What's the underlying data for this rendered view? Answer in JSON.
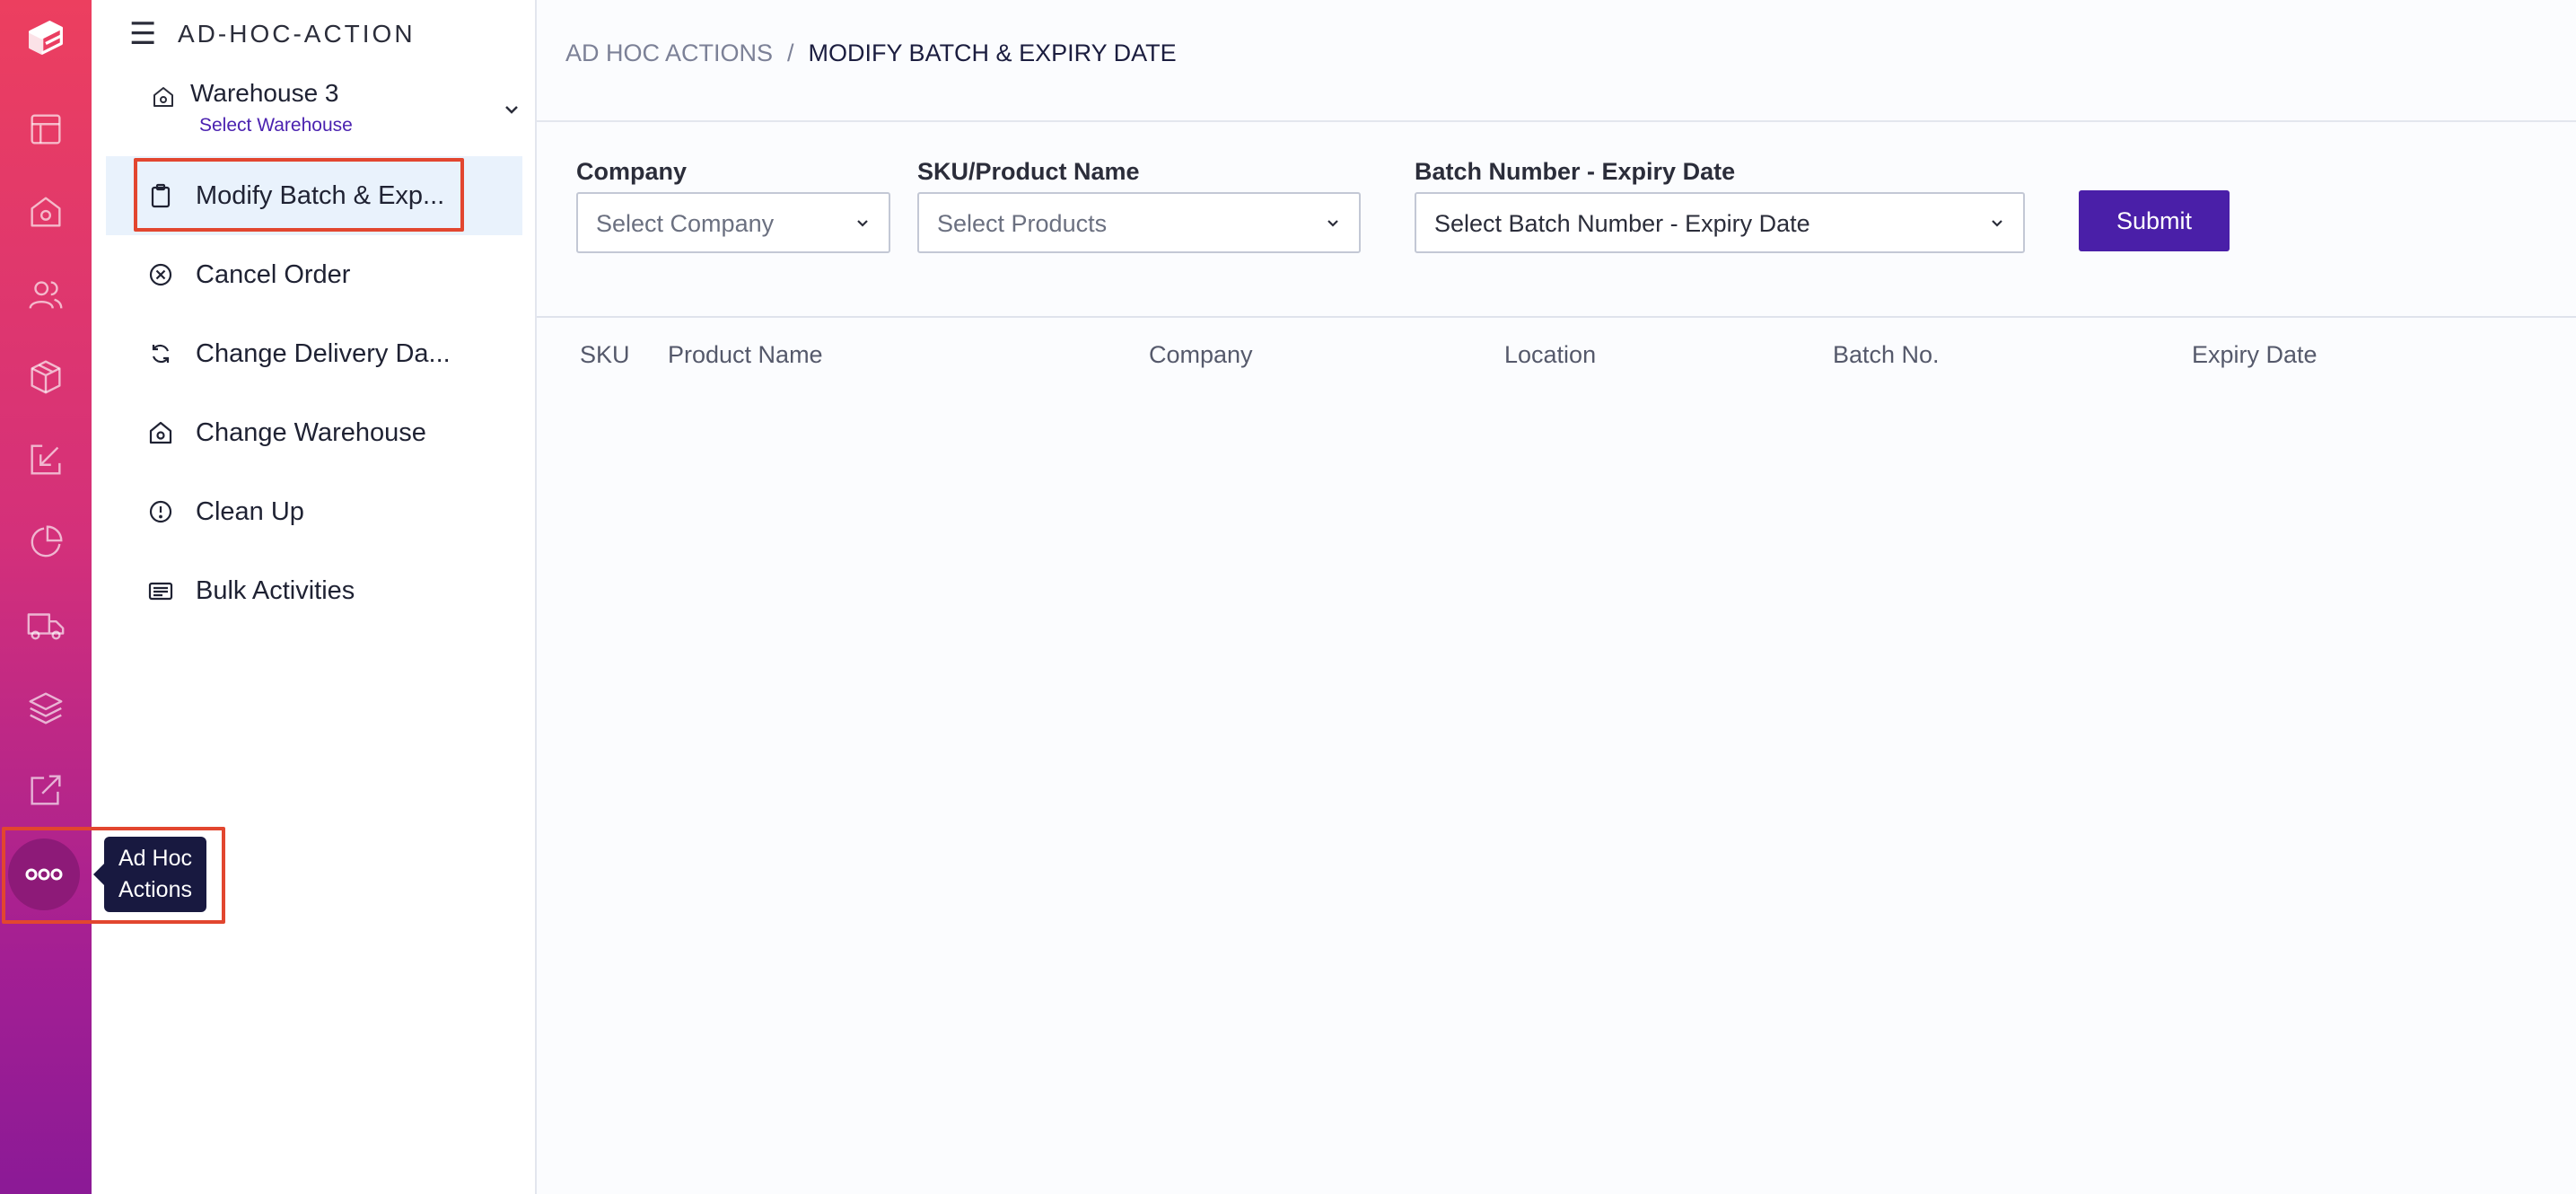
{
  "rail": {
    "icons": [
      "logo-icon",
      "dashboard-icon",
      "warehouse-icon",
      "users-icon",
      "package-icon",
      "inbound-icon",
      "reports-icon",
      "truck-icon",
      "layers-icon",
      "external-link-icon"
    ],
    "more_icon": "more-dots-icon"
  },
  "tooltip": {
    "text": "Ad Hoc\nActions"
  },
  "sidebar": {
    "title": "AD-HOC-ACTION",
    "warehouse": {
      "name": "Warehouse 3",
      "sublabel": "Select Warehouse"
    },
    "items": [
      {
        "label": "Modify Batch & Exp...",
        "icon": "clipboard-icon",
        "active": true
      },
      {
        "label": "Cancel Order",
        "icon": "cancel-circle-icon",
        "active": false
      },
      {
        "label": "Change Delivery Da...",
        "icon": "refresh-icon",
        "active": false
      },
      {
        "label": "Change Warehouse",
        "icon": "warehouse-icon",
        "active": false
      },
      {
        "label": "Clean Up",
        "icon": "alert-circle-icon",
        "active": false
      },
      {
        "label": "Bulk Activities",
        "icon": "list-card-icon",
        "active": false
      }
    ]
  },
  "breadcrumb": {
    "parent": "AD HOC ACTIONS",
    "separator": "/",
    "current": "MODIFY BATCH & EXPIRY DATE"
  },
  "filters": {
    "company": {
      "label": "Company",
      "placeholder": "Select Company"
    },
    "product": {
      "label": "SKU/Product Name",
      "placeholder": "Select Products"
    },
    "batch": {
      "label": "Batch Number - Expiry Date",
      "placeholder": "Select Batch Number - Expiry Date"
    },
    "submit_label": "Submit"
  },
  "table": {
    "columns": [
      "SKU",
      "Product Name",
      "Company",
      "Location",
      "Batch No.",
      "Expiry Date"
    ],
    "rows": []
  },
  "colors": {
    "rail_gradient_top": "#ec3f5f",
    "rail_gradient_bottom": "#8b1a96",
    "accent": "#4a1fa8",
    "active_nav_bg": "#e9f2fc",
    "highlight": "#e2462f",
    "tooltip_bg": "#181940"
  }
}
